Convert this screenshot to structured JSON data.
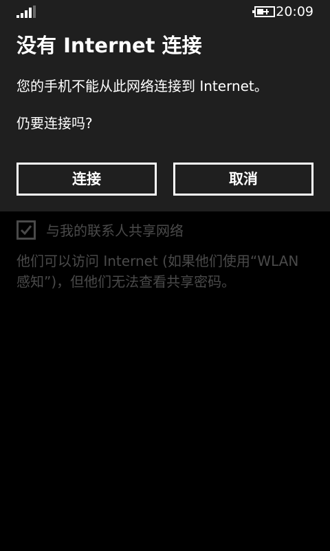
{
  "status_bar": {
    "time": "20:09",
    "signal_icon": "signal-strength-icon",
    "battery_icon": "battery-charging-icon"
  },
  "dialog": {
    "title": "没有 Internet 连接",
    "message": "您的手机不能从此网络连接到 Internet。",
    "question": "仍要连接吗?",
    "connect_label": "连接",
    "cancel_label": "取消"
  },
  "background": {
    "share_checkbox_checked": true,
    "share_label": "与我的联系人共享网络",
    "share_description": "他们可以访问 Internet (如果他们使用“WLAN 感知”)，但他们无法查看共享密码。"
  },
  "colors": {
    "dialog_background": "#1f1f1f",
    "page_background": "#000000",
    "dimmed_text": "#4a4a4a",
    "text": "#ffffff"
  }
}
